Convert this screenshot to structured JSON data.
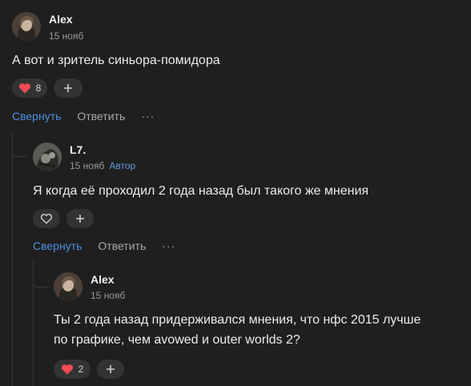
{
  "comments": [
    {
      "author": "Alex",
      "date": "15 нояб",
      "text": "А вот и зритель синьора-помидора",
      "likes": "8",
      "collapse_label": "Свернуть",
      "reply_label": "Ответить",
      "more_label": "···"
    },
    {
      "author": "L7.",
      "date": "15 нояб",
      "badge": "Автор",
      "text": "Я когда её проходил 2 года назад был такого же мнения",
      "collapse_label": "Свернуть",
      "reply_label": "Ответить",
      "more_label": "···"
    },
    {
      "author": "Alex",
      "date": "15 нояб",
      "text_line1": "Ты 2 года назад придерживался мнения, что нфс 2015 лучше",
      "text_line2": "по графике, чем avowed и outer worlds 2?",
      "likes": "2"
    }
  ],
  "icons": {
    "heart_filled": "heart-filled-icon",
    "heart_outline": "heart-outline-icon",
    "add_reaction": "plus-icon"
  },
  "colors": {
    "background": "#1f1f1f",
    "accent": "#4f8fe0",
    "like": "#f04a55"
  }
}
